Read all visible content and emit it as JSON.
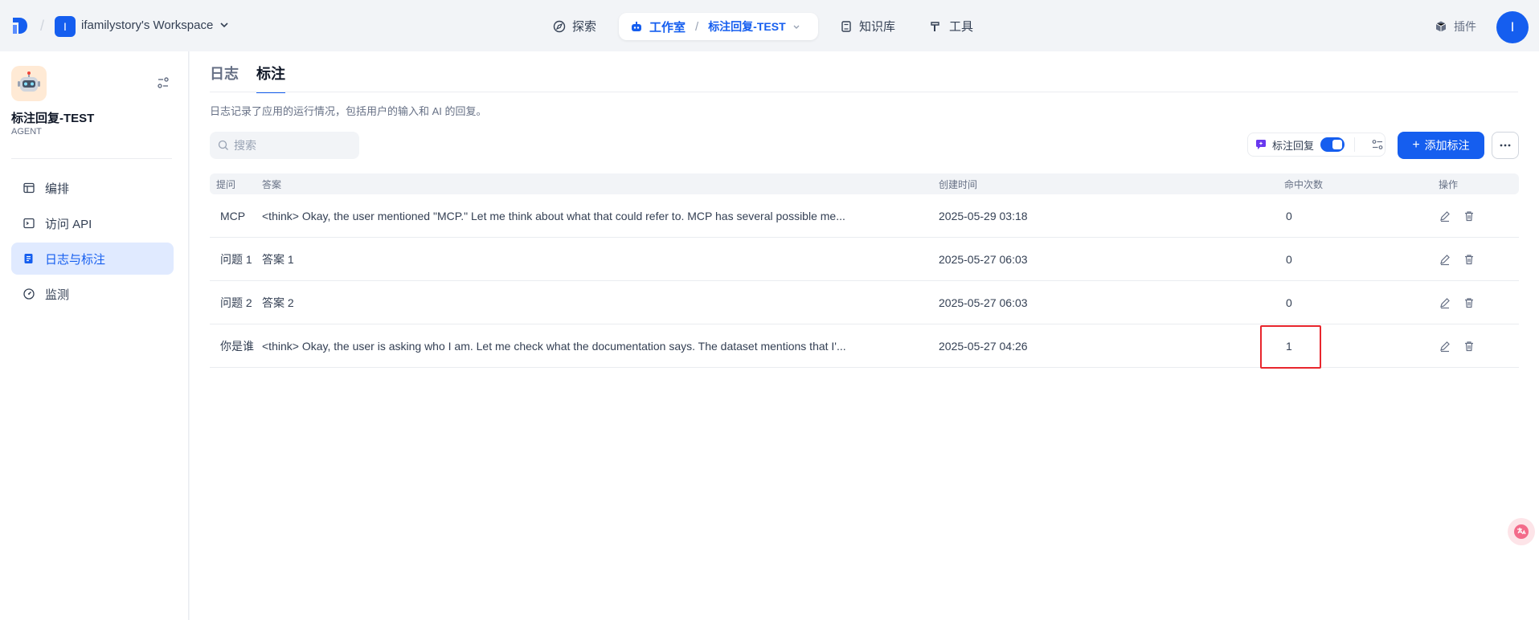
{
  "topbar": {
    "workspace_initial": "I",
    "workspace_name": "ifamilystory's Workspace",
    "nav_explore": "探索",
    "nav_studio": "工作室",
    "nav_app": "标注回复-TEST",
    "nav_knowledge": "知识库",
    "nav_tools": "工具",
    "plugins": "插件",
    "user_initial": "I"
  },
  "sidebar": {
    "app_name": "标注回复-TEST",
    "app_type": "AGENT",
    "items": [
      {
        "label": "编排",
        "icon": "layout-icon"
      },
      {
        "label": "访问 API",
        "icon": "terminal-icon"
      },
      {
        "label": "日志与标注",
        "icon": "document-icon",
        "active": true
      },
      {
        "label": "监测",
        "icon": "gauge-icon"
      }
    ]
  },
  "main": {
    "tabs": [
      {
        "label": "日志"
      },
      {
        "label": "标注",
        "active": true
      }
    ],
    "description": "日志记录了应用的运行情况，包括用户的输入和 AI 的回复。",
    "search_placeholder": "搜索",
    "annotation_reply_label": "标注回复",
    "annotation_reply_enabled": true,
    "add_button": "添加标注",
    "table": {
      "headers": {
        "question": "提问",
        "answer": "答案",
        "created": "创建时间",
        "hits": "命中次数",
        "actions": "操作"
      },
      "rows": [
        {
          "question": "MCP",
          "answer": "<think> Okay, the user mentioned \"MCP.\" Let me think about what that could refer to. MCP has several possible me...",
          "created": "2025-05-29 03:18",
          "hits": "0"
        },
        {
          "question": "问题 1",
          "answer": "答案 1",
          "created": "2025-05-27 06:03",
          "hits": "0"
        },
        {
          "question": "问题 2",
          "answer": "答案 2",
          "created": "2025-05-27 06:03",
          "hits": "0"
        },
        {
          "question": "你是谁",
          "answer": "<think> Okay, the user is asking who I am. Let me check what the documentation says. The dataset mentions that I'...",
          "created": "2025-05-27 04:26",
          "hits": "1"
        }
      ]
    }
  },
  "colors": {
    "primary": "#155eef",
    "highlight": "#e8262d"
  }
}
